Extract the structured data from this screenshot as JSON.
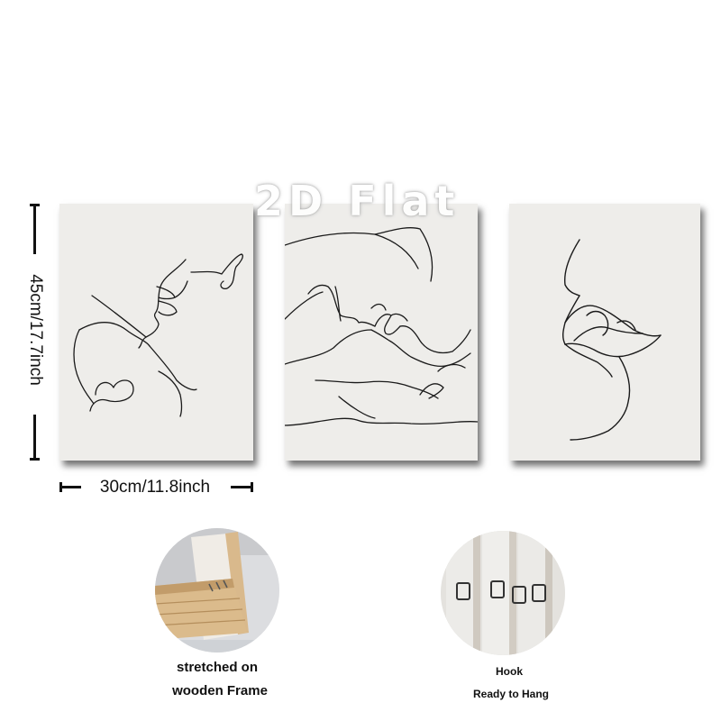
{
  "dimensions": {
    "height": "45cm/17.7inch",
    "width": "30cm/11.8inch"
  },
  "watermark": "2D Flat",
  "panels": [
    {
      "name": "panel-left",
      "artwork": "line-art-kiss-profile-with-heart"
    },
    {
      "name": "panel-center",
      "artwork": "line-art-couple-embrace"
    },
    {
      "name": "panel-right",
      "artwork": "line-art-lips-close-up"
    }
  ],
  "details": {
    "frame": {
      "line1": "stretched on",
      "line2": "wooden Frame",
      "icon": "wooden-frame-corner-photo"
    },
    "hook": {
      "line1": "Hook",
      "line2": "Ready to Hang",
      "icon": "hanging-hook-photo"
    }
  },
  "colors": {
    "canvas": "#eeedea",
    "line_art": "#1a1a1a",
    "wood": "#d9b98c"
  }
}
